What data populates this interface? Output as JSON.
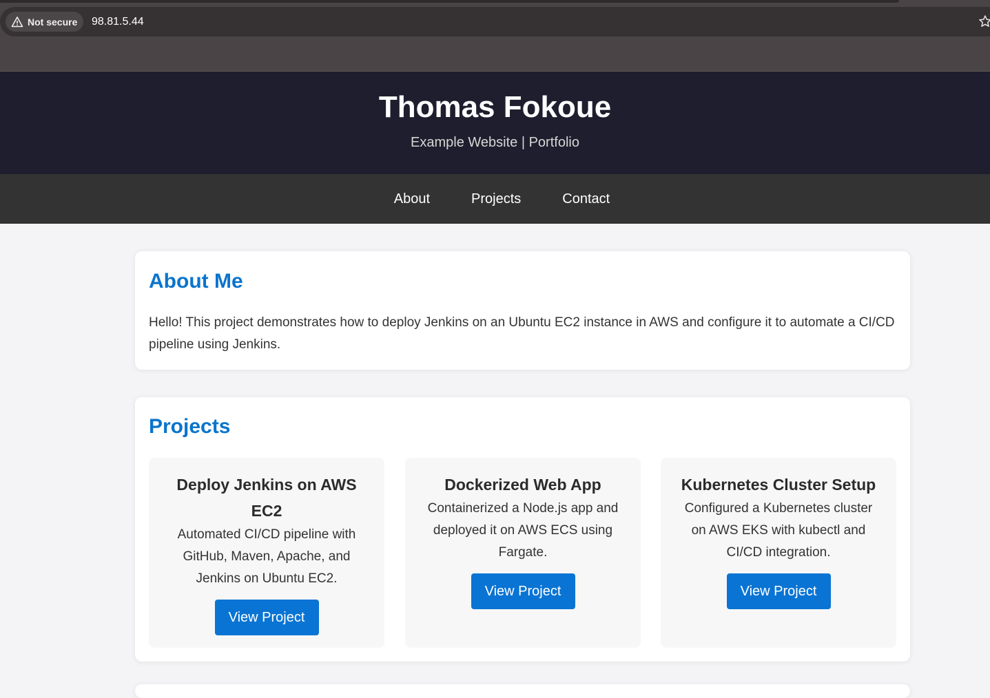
{
  "browser": {
    "security_label": "Not secure",
    "url": "98.81.5.44"
  },
  "header": {
    "title": "Thomas Fokoue",
    "subtitle": "Example Website | Portfolio"
  },
  "nav": {
    "items": [
      {
        "label": "About"
      },
      {
        "label": "Projects"
      },
      {
        "label": "Contact"
      }
    ]
  },
  "about": {
    "heading": "About Me",
    "text": "Hello! This project demonstrates how to deploy Jenkins on an Ubuntu EC2 instance in AWS and configure it to automate a CI/CD pipeline using Jenkins."
  },
  "projects": {
    "heading": "Projects",
    "items": [
      {
        "title": "Deploy Jenkins on AWS EC2",
        "description": "Automated CI/CD pipeline with GitHub, Maven, Apache, and Jenkins on Ubuntu EC2.",
        "button": "View Project"
      },
      {
        "title": "Dockerized Web App",
        "description": "Containerized a Node.js app and deployed it on AWS ECS using Fargate.",
        "button": "View Project"
      },
      {
        "title": "Kubernetes Cluster Setup",
        "description": "Configured a Kubernetes cluster on AWS EKS with kubectl and CI/CD integration.",
        "button": "View Project"
      }
    ]
  },
  "colors": {
    "header_bg": "#1f1e2e",
    "nav_bg": "#333333",
    "accent": "#0a74d4",
    "page_bg": "#f4f4f6"
  },
  "icons": {
    "security": "warning-triangle-icon",
    "bookmark": "star-icon"
  }
}
